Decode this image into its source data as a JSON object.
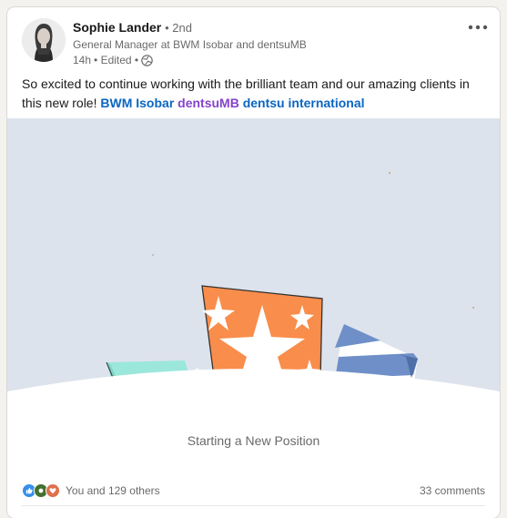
{
  "post": {
    "author": {
      "name": "Sophie Lander",
      "degree": "• 2nd",
      "headline": "General Manager at BWM Isobar and dentsuMB",
      "time": "14h",
      "edited": "• Edited •"
    },
    "text_before": "So excited to continue working with the brilliant team and our amazing clients in this new role! ",
    "mentions": [
      "BWM Isobar",
      "dentsuMB",
      "dentsu international"
    ],
    "media_caption": "Starting a New Position",
    "reactions_text": "You and 129 others",
    "comments_text": "33 comments",
    "icons": {
      "more": "more-options-icon",
      "visibility": "globe-icon",
      "reactions": [
        "like-icon",
        "celebrate-icon",
        "love-icon"
      ]
    }
  },
  "colors": {
    "link": "#0a66c2",
    "mention_purple": "#8344cc",
    "media_bg": "#dde3ec",
    "orange": "#f98d4b",
    "teal": "#9be7dc",
    "blue_stripe": "#6f8fc8"
  }
}
